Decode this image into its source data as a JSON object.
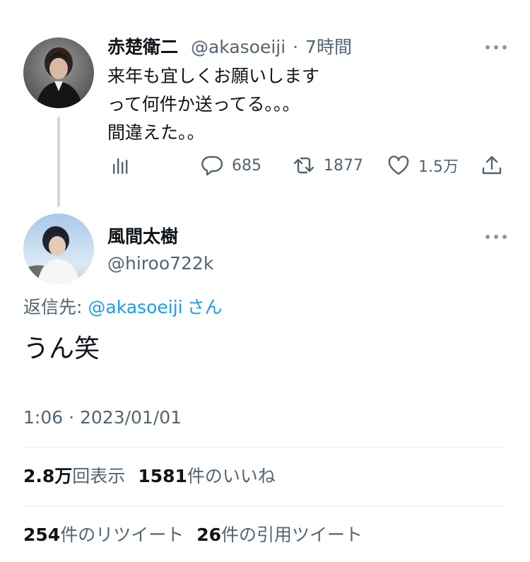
{
  "tweet1": {
    "author_name": "赤楚衛二",
    "handle": "@akasoeiji",
    "separator": "·",
    "time_ago": "7時間",
    "lines": [
      "来年も宜しくお願いします",
      "って何件か送ってる。。。",
      "間違えた。。"
    ],
    "actions": {
      "replies": "685",
      "retweets": "1877",
      "likes": "1.5万"
    }
  },
  "tweet2": {
    "author_name": "風間太樹",
    "handle": "@hiroo722k",
    "reply_label": "返信先: ",
    "reply_handle": "@akasoeiji",
    "reply_suffix": "さん",
    "text": "うん笑",
    "timestamp": "1:06 · 2023/01/01",
    "stats": {
      "views_count": "2.8万",
      "views_label": "回表示",
      "likes_count": "1581",
      "likes_label": "件のいいね",
      "retweets_count": "254",
      "retweets_label": "件のリツイート",
      "quotes_count": "26",
      "quotes_label": "件の引用ツイート"
    }
  },
  "icons": {
    "analytics": "bar-chart-icon",
    "reply": "speech-bubble-icon",
    "retweet": "retweet-arrows-icon",
    "like": "heart-icon",
    "share": "upload-icon",
    "more": "ellipsis-icon"
  },
  "colors": {
    "link": "#1d9bf0",
    "secondary_text": "#536471",
    "primary_text": "#0f1419"
  }
}
